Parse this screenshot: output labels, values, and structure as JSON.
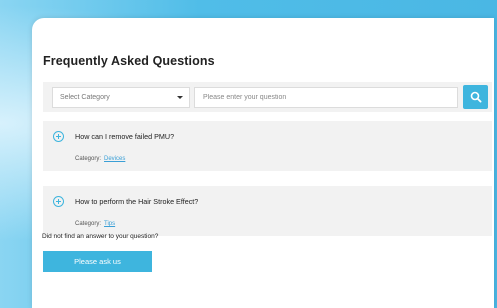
{
  "faq": {
    "title": "Frequently Asked Questions",
    "search": {
      "category_placeholder": "Select Category",
      "question_placeholder": "Please enter your question"
    },
    "items": [
      {
        "question": "How can I remove failed PMU?",
        "category_label": "Category:",
        "category": "Devices"
      },
      {
        "question": "How to perform the Hair Stroke Effect?",
        "category_label": "Category:",
        "category": "Tips"
      }
    ],
    "not_found_text": "Did not find an answer to your question?",
    "ask_button": "Please ask us"
  },
  "colors": {
    "accent": "#3eb5de",
    "background": "#5cc3ec",
    "link": "#3a9fd6"
  },
  "icons": {
    "search": "search-icon",
    "expand": "plus-circle-icon",
    "dropdown": "chevron-down-icon"
  }
}
